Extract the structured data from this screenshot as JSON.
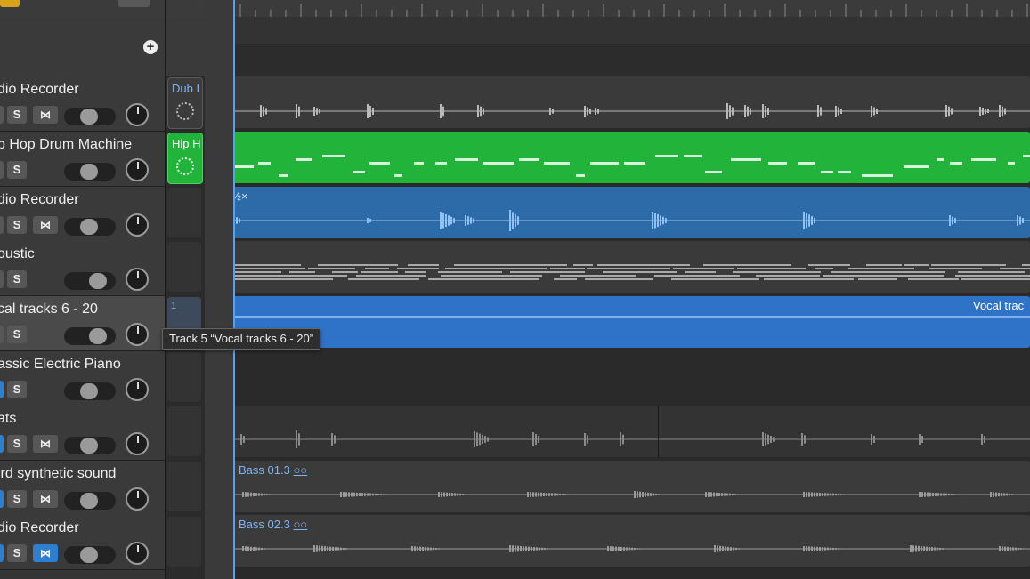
{
  "colors": {
    "accent_blue": "#2f7fd1",
    "playhead": "#5aa0f0",
    "green_region": "#22b33a",
    "blue_region": "#2d6aa8",
    "vocal_region": "#2f73c9"
  },
  "tracks_header": {
    "add_icon": "plus-circle-icon"
  },
  "tracks": [
    {
      "name": "dio Recorder",
      "solo": "S",
      "mute_on": false,
      "input_on": false,
      "has_input": true
    },
    {
      "name": "p Hop Drum Machine",
      "solo": "S",
      "mute_on": false,
      "input_on": false,
      "has_input": false
    },
    {
      "name": "dio Recorder",
      "solo": "S",
      "mute_on": false,
      "input_on": false,
      "has_input": true
    },
    {
      "name": "oustic",
      "solo": "S",
      "mute_on": false,
      "input_on": false,
      "has_input": false
    },
    {
      "name": "cal tracks 6 - 20",
      "solo": "S",
      "mute_on": false,
      "input_on": false,
      "has_input": false
    },
    {
      "name": "assic Electric Piano",
      "solo": "S",
      "mute_on": true,
      "input_on": false,
      "has_input": false
    },
    {
      "name": "ats",
      "solo": "S",
      "mute_on": true,
      "input_on": false,
      "has_input": true
    },
    {
      "name": "ird synthetic sound",
      "solo": "S",
      "mute_on": true,
      "input_on": false,
      "has_input": true
    },
    {
      "name": "dio Recorder",
      "solo": "S",
      "mute_on": true,
      "input_on": true,
      "has_input": true
    }
  ],
  "live_loops": {
    "cell1": "Dub I",
    "cell2": "Hip H",
    "cell5": "1"
  },
  "regions": {
    "track3_label": "½×",
    "track5_label": "Vocal trac",
    "track8_label": "Bass 01.3",
    "track9_label": "Bass 02.3",
    "loop_icon_glyph": "○○"
  },
  "tooltip": "Track 5 “Vocal tracks 6 - 20”"
}
